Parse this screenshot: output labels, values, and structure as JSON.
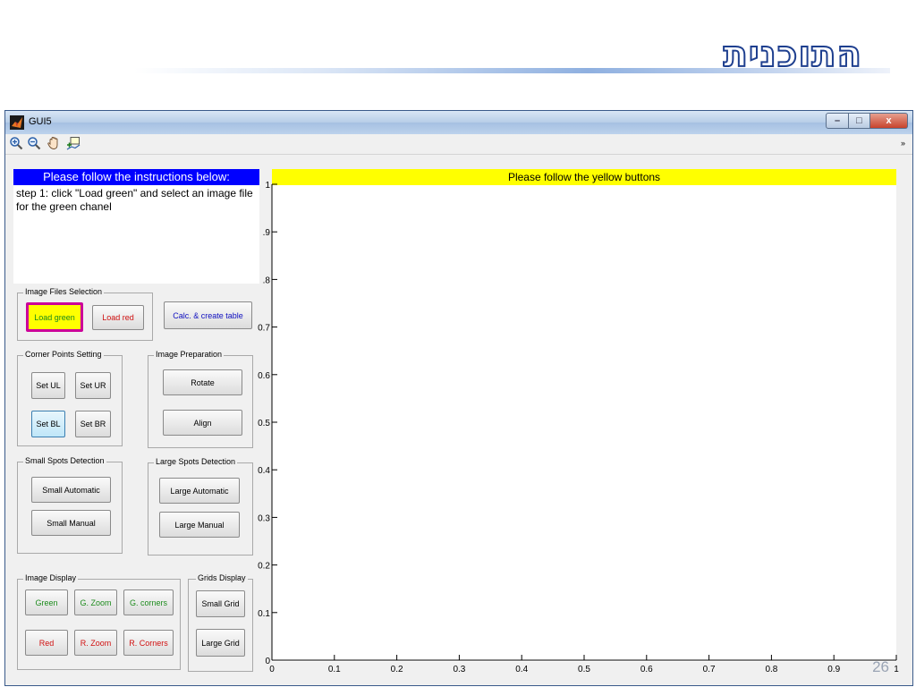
{
  "slide": {
    "title": "התוכנית",
    "page_number": "26"
  },
  "window": {
    "title": "GUI5",
    "controls": [
      "–",
      "□",
      "x"
    ]
  },
  "toolbar": {
    "tools": [
      "zoom-in-icon",
      "zoom-out-icon",
      "pan-hand-icon",
      "data-cursor-icon"
    ],
    "overflow_arrow": "»"
  },
  "instructions": {
    "header": "Please follow the instructions below:",
    "text": "step 1: click \"Load green\" and select an image file for the green chanel"
  },
  "groups": {
    "image_files": {
      "label": "Image Files Selection",
      "load_green": "Load green",
      "load_red": "Load red"
    },
    "calc_button": "Calc. & create table",
    "corner_points": {
      "label": "Corner Points Setting",
      "set_ul": "Set UL",
      "set_ur": "Set UR",
      "set_bl": "Set BL",
      "set_br": "Set BR"
    },
    "image_prep": {
      "label": "Image Preparation",
      "rotate": "Rotate",
      "align": "Align"
    },
    "small_spots": {
      "label": "Small Spots Detection",
      "automatic": "Small Automatic",
      "manual": "Small Manual"
    },
    "large_spots": {
      "label": "Large Spots Detection",
      "automatic": "Large Automatic",
      "manual": "Large Manual"
    },
    "image_display": {
      "label": "Image Display",
      "green": "Green",
      "g_zoom": "G. Zoom",
      "g_corners": "G. corners",
      "red": "Red",
      "r_zoom": "R. Zoom",
      "r_corners": "R. Corners"
    },
    "grids_display": {
      "label": "Grids Display",
      "small_grid": "Small Grid",
      "large_grid": "Large Grid"
    }
  },
  "plot": {
    "banner": "Please follow the yellow buttons",
    "x_ticks": [
      "0",
      "0.1",
      "0.2",
      "0.3",
      "0.4",
      "0.5",
      "0.6",
      "0.7",
      "0.8",
      "0.9",
      "1"
    ],
    "y_ticks": [
      "0",
      "0.1",
      "0.2",
      "0.3",
      "0.4",
      "0.5",
      "0.6",
      "0.7",
      ".8",
      ".9",
      "1"
    ]
  },
  "colors": {
    "instruction_header": "#0000ff",
    "banner": "#ffff00",
    "highlight_border": "#cc0099",
    "green_text": "#1b8a1b",
    "red_text": "#d01010",
    "blue_text": "#1010c0"
  }
}
